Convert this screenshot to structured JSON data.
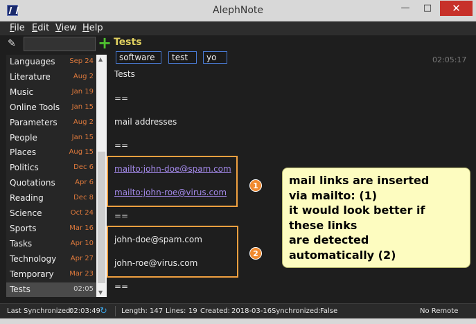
{
  "window": {
    "title": "AlephNote",
    "min_glyph": "—",
    "max_glyph": "□",
    "close_glyph": "✕"
  },
  "menu": {
    "file": {
      "accel": "F",
      "rest": "ile"
    },
    "edit": {
      "accel": "E",
      "rest": "dit"
    },
    "view": {
      "accel": "V",
      "rest": "iew"
    },
    "help": {
      "accel": "H",
      "rest": "elp"
    }
  },
  "sidebar": {
    "search_value": "",
    "add_glyph": "+",
    "tag_glyph": "✎",
    "notes": [
      {
        "title": "Languages",
        "date": "Sep 24"
      },
      {
        "title": "Literature",
        "date": "Aug 2"
      },
      {
        "title": "Music",
        "date": "Jan 19"
      },
      {
        "title": "Online Tools",
        "date": "Jan 15"
      },
      {
        "title": "Parameters",
        "date": "Aug 2"
      },
      {
        "title": "People",
        "date": "Jan 15"
      },
      {
        "title": "Places",
        "date": "Aug 15"
      },
      {
        "title": "Politics",
        "date": "Dec 6"
      },
      {
        "title": "Quotations",
        "date": "Apr 6"
      },
      {
        "title": "Reading",
        "date": "Dec 8"
      },
      {
        "title": "Science",
        "date": "Oct 24"
      },
      {
        "title": "Sports",
        "date": "Mar 16"
      },
      {
        "title": "Tasks",
        "date": "Apr 10"
      },
      {
        "title": "Technology",
        "date": "Apr 27"
      },
      {
        "title": "Temporary",
        "date": "Mar 23"
      },
      {
        "title": "Tests",
        "date": "02:05",
        "selected": true
      }
    ],
    "scroll_up": "▲",
    "scroll_down": "▼"
  },
  "note": {
    "title": "Tests",
    "tags": [
      "software",
      "test",
      "yo"
    ],
    "time": "02:05:17",
    "lines": [
      {
        "text": "Tests",
        "link": false
      },
      {
        "text": "==",
        "link": false
      },
      {
        "text": "mail addresses",
        "link": false
      },
      {
        "text": "==",
        "link": false
      },
      {
        "text": "mailto:john-doe@spam.com",
        "link": true
      },
      {
        "text": "mailto:john-roe@virus.com",
        "link": true
      },
      {
        "text": "==",
        "link": false
      },
      {
        "text": "john-doe@spam.com",
        "link": false
      },
      {
        "text": "john-roe@virus.com",
        "link": false
      },
      {
        "text": "==",
        "link": false
      }
    ]
  },
  "annotation": {
    "num1": "1",
    "num2": "2",
    "callout": [
      "mail links are inserted",
      "via mailto: (1)",
      "it would look better if",
      "these links",
      "are detected",
      "automatically (2)"
    ]
  },
  "status": {
    "last_sync_label": "Last Synchronized:",
    "last_sync_value": "02:03:49",
    "sync_glyph": "↻",
    "length_label": "Length:",
    "length_value": "147",
    "lines_label": "Lines:",
    "lines_value": "19",
    "created_label": "Created:",
    "created_value": "2018-03-16",
    "synchronized_label": "Synchronized:",
    "synchronized_value": "False",
    "remote": "No Remote"
  },
  "colors": {
    "accent_date": "#e07a3c",
    "heading": "#e0d060",
    "link": "#a288e8",
    "annotation": "#f0a040",
    "callout_bg": "#fdfcc0"
  }
}
